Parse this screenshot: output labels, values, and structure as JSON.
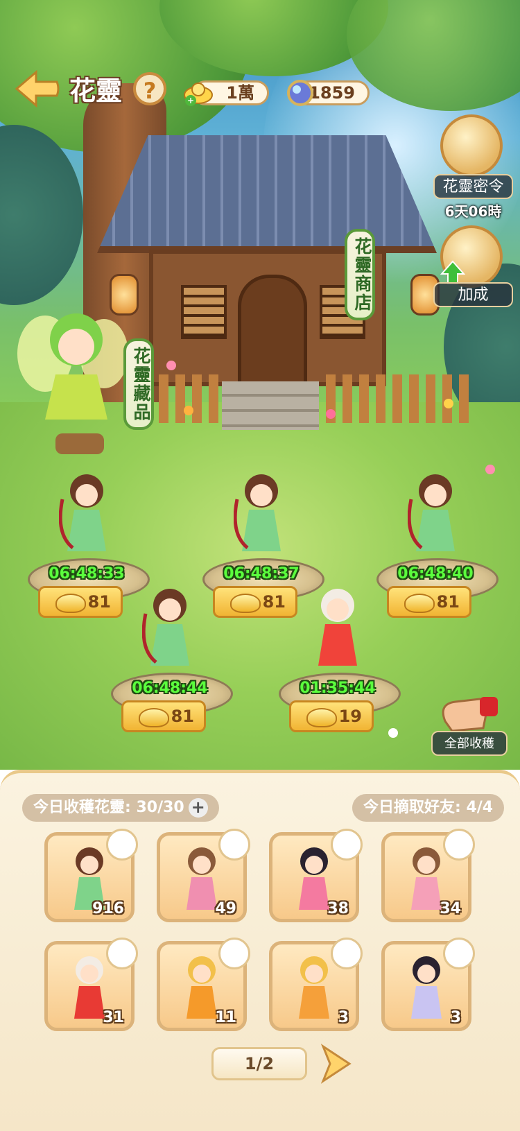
{
  "header": {
    "title": "花靈",
    "help_label": "?",
    "currency_gold": "1萬",
    "currency_gem": "1859"
  },
  "side": {
    "pass_label": "花靈密令",
    "pass_timer": "6天06時",
    "boost_label": "加成"
  },
  "signs": {
    "shop": "花靈商店",
    "collection": "花靈藏品"
  },
  "plots": [
    {
      "timer": "06:48:33",
      "reward": "81"
    },
    {
      "timer": "06:48:37",
      "reward": "81"
    },
    {
      "timer": "06:48:40",
      "reward": "81"
    },
    {
      "timer": "06:48:44",
      "reward": "81"
    },
    {
      "timer": "01:35:44",
      "reward": "19"
    }
  ],
  "collect_all_label": "全部收穫",
  "stats": {
    "harvest_today": "今日收穫花靈: 30/30",
    "pick_friends": "今日摘取好友: 4/4"
  },
  "cards": [
    {
      "count": "916"
    },
    {
      "count": "49"
    },
    {
      "count": "38"
    },
    {
      "count": "34"
    },
    {
      "count": "31"
    },
    {
      "count": "11"
    },
    {
      "count": "3"
    },
    {
      "count": "3"
    }
  ],
  "pager": "1/2",
  "colors": {
    "accent_green": "#5bff3d",
    "gold": "#f1b433",
    "panel": "#fbf3e0"
  }
}
